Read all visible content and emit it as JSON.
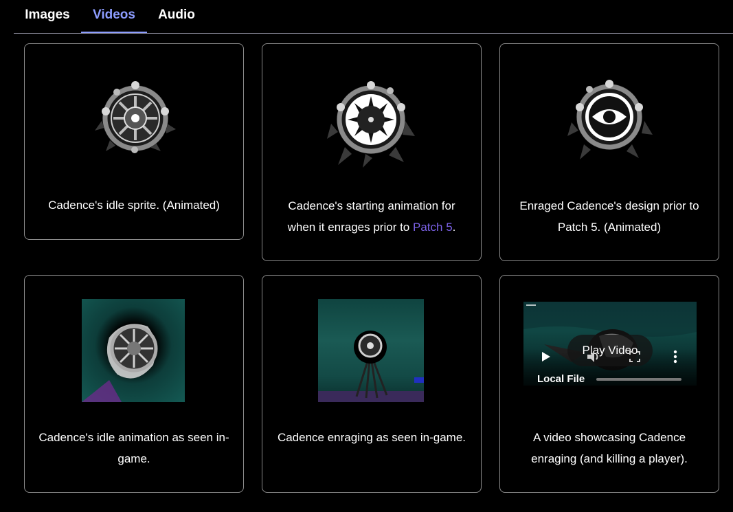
{
  "tabs": [
    {
      "label": "Images",
      "active": false
    },
    {
      "label": "Videos",
      "active": true
    },
    {
      "label": "Audio",
      "active": false
    }
  ],
  "cards": [
    {
      "caption": "Cadence's idle sprite. (Animated)"
    },
    {
      "caption_before": "Cadence's starting animation for when it enrages prior to ",
      "link_text": "Patch 5",
      "caption_after": "."
    },
    {
      "caption": "Enraged Cadence's design prior to Patch 5. (Animated)"
    },
    {
      "caption": "Cadence's idle animation as seen in-game."
    },
    {
      "caption": "Cadence enraging as seen in-game."
    },
    {
      "caption": "A video showcasing Cadence enraging (and killing a player)."
    }
  ],
  "video_player": {
    "play_label": "Play Video",
    "source_label": "Local File",
    "progress": 0
  },
  "icons": [
    "play-icon",
    "volume-icon",
    "fullscreen-icon",
    "more-options-icon"
  ],
  "colors": {
    "accent": "#8d9dff",
    "link": "#7c62e8",
    "border": "#8c8c8c",
    "background": "#000000"
  }
}
